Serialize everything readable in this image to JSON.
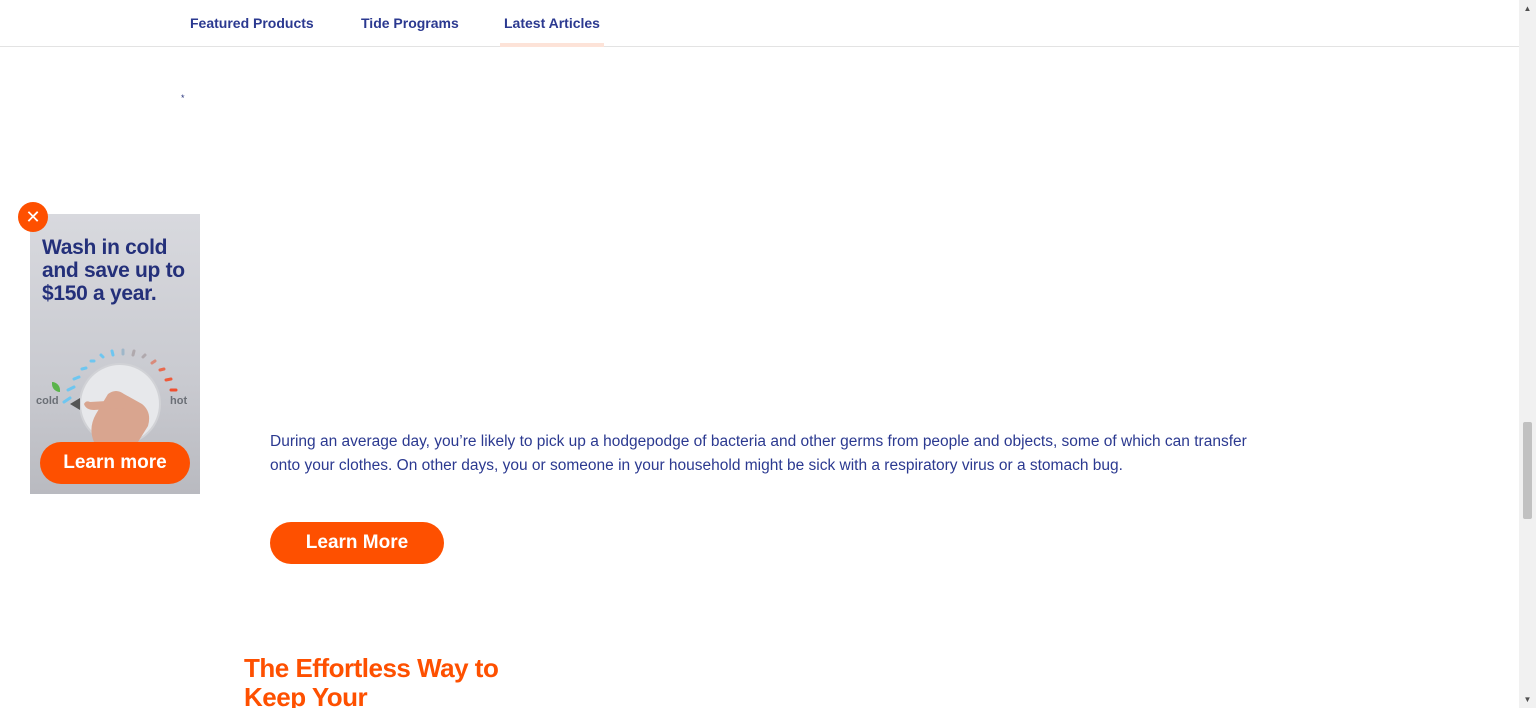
{
  "nav": {
    "tabs": [
      {
        "label": "Featured Products"
      },
      {
        "label": "Tide Programs"
      },
      {
        "label": "Latest Articles"
      }
    ],
    "active_tab": "Latest Articles"
  },
  "ad": {
    "headline": "Wash in cold and save up to $150 a year.",
    "asterisk": "*",
    "dial_cold_label": "cold",
    "dial_hot_label": "hot",
    "cta_label": "Learn more",
    "close_icon": "close-icon"
  },
  "article": {
    "body": "During an average day, you’re likely to pick up a hodgepodge of bacteria and other germs from people and objects, some of which can transfer onto your clothes. On other days, you or someone in your household might be sick with a respiratory virus or a stomach bug.",
    "cta_label": "Learn More"
  },
  "next_section": {
    "heading": "The Effortless Way to Keep Your"
  },
  "colors": {
    "brand_orange": "#fe5000",
    "brand_navy": "#2b3990"
  }
}
